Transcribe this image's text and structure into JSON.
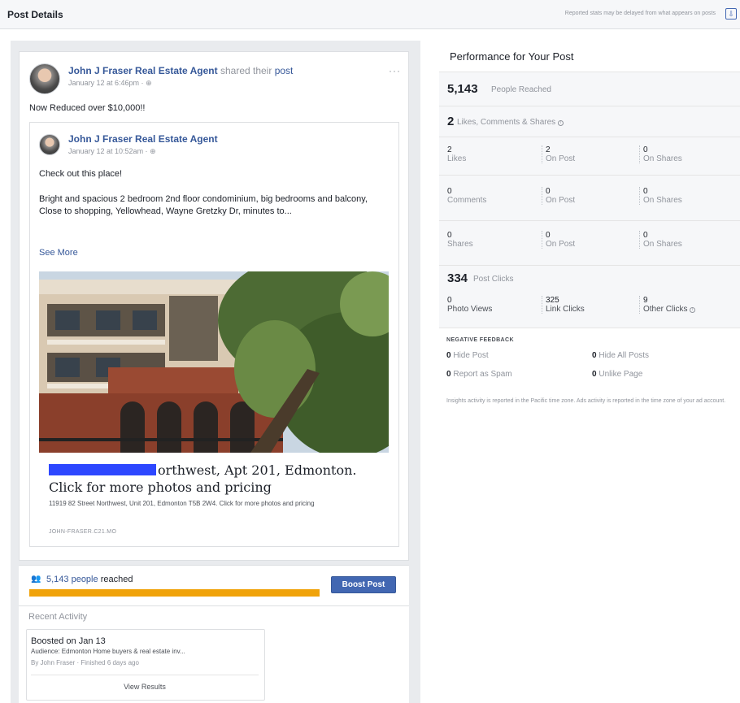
{
  "header": {
    "title": "Post Details",
    "note": "Reported stats may be delayed from what appears on posts"
  },
  "post": {
    "author": "John J Fraser Real Estate Agent",
    "shared_text": "shared their",
    "post_link": "post",
    "time": "January 12 at 6:46pm · ",
    "text": "Now Reduced over $10,000!!",
    "shared": {
      "author": "John J Fraser Real Estate Agent",
      "time": "January 12 at 10:52am · ",
      "headline": "Check out this place!",
      "body": "Bright and spacious 2 bedroom 2nd floor condominium, big bedrooms and balcony, Close to shopping, Yellowhead, Wayne Gretzky Dr, minutes to...",
      "see_more": "See More",
      "link_title": "orthwest, Apt 201, Edmonton. Click for more photos and pricing",
      "link_desc": "11919 82 Street Northwest, Unit 201, Edmonton T5B 2W4. Click for more photos and pricing",
      "link_domain": "JOHN-FRASER.C21.MO"
    }
  },
  "reach": {
    "count_link": "5,143 people",
    "suffix": "reached",
    "boost_label": "Boost Post",
    "bar_fill": 1.0
  },
  "recent": {
    "title": "Recent Activity",
    "activity_title": "Boosted on Jan 13",
    "audience": "Audience: Edmonton Home buyers & real estate inv...",
    "by": "By John Fraser · Finished 6 days ago",
    "view_results": "View Results"
  },
  "performance": {
    "title": "Performance for Your Post",
    "reached_num": "5,143",
    "reached_label": "People Reached",
    "engagement_num": "2",
    "engagement_label": "Likes, Comments & Shares",
    "likes": [
      {
        "n": "2",
        "l": "Likes"
      },
      {
        "n": "2",
        "l": "On Post"
      },
      {
        "n": "0",
        "l": "On Shares"
      }
    ],
    "comments": [
      {
        "n": "0",
        "l": "Comments"
      },
      {
        "n": "0",
        "l": "On Post"
      },
      {
        "n": "0",
        "l": "On Shares"
      }
    ],
    "shares": [
      {
        "n": "0",
        "l": "Shares"
      },
      {
        "n": "0",
        "l": "On Post"
      },
      {
        "n": "0",
        "l": "On Shares"
      }
    ],
    "clicks_num": "334",
    "clicks_label": "Post Clicks",
    "clicks": [
      {
        "n": "0",
        "l": "Photo Views"
      },
      {
        "n": "325",
        "l": "Link Clicks"
      },
      {
        "n": "9",
        "l": "Other Clicks"
      }
    ],
    "negative": {
      "title": "NEGATIVE FEEDBACK",
      "hide_post": {
        "n": "0",
        "l": "Hide Post"
      },
      "hide_all": {
        "n": "0",
        "l": "Hide All Posts"
      },
      "spam": {
        "n": "0",
        "l": "Report as Spam"
      },
      "unlike": {
        "n": "0",
        "l": "Unlike Page"
      }
    },
    "footnote": "Insights activity is reported in the Pacific time zone. Ads activity is reported in the time zone of your ad account."
  },
  "icons": {
    "globe": "globe-icon",
    "more": "more-icon",
    "people": "people-icon",
    "info": "info-icon"
  },
  "colors": {
    "link": "#365899",
    "button": "#4267b2",
    "reach_bar": "#f0a30a"
  }
}
